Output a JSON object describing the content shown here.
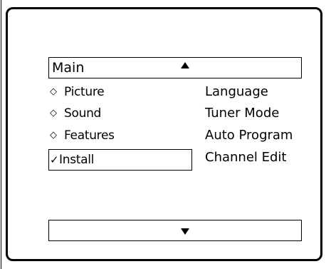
{
  "menu": {
    "title": "Main",
    "up_indicator_icon": "triangle-up-icon",
    "down_indicator_icon": "triangle-down-icon",
    "left_items": [
      {
        "label": "Picture",
        "marker": "◇",
        "icon": "diamond-icon",
        "selected": false
      },
      {
        "label": "Sound",
        "marker": "◇",
        "icon": "diamond-icon",
        "selected": false
      },
      {
        "label": "Features",
        "marker": "◇",
        "icon": "diamond-icon",
        "selected": false
      },
      {
        "label": "Install",
        "marker": "✓",
        "icon": "checkmark-icon",
        "selected": true
      }
    ],
    "right_items": [
      {
        "label": "Language"
      },
      {
        "label": "Tuner Mode"
      },
      {
        "label": "Auto Program"
      },
      {
        "label": "Channel Edit"
      }
    ]
  },
  "colors": {
    "foreground": "#000000",
    "background": "#ffffff"
  }
}
